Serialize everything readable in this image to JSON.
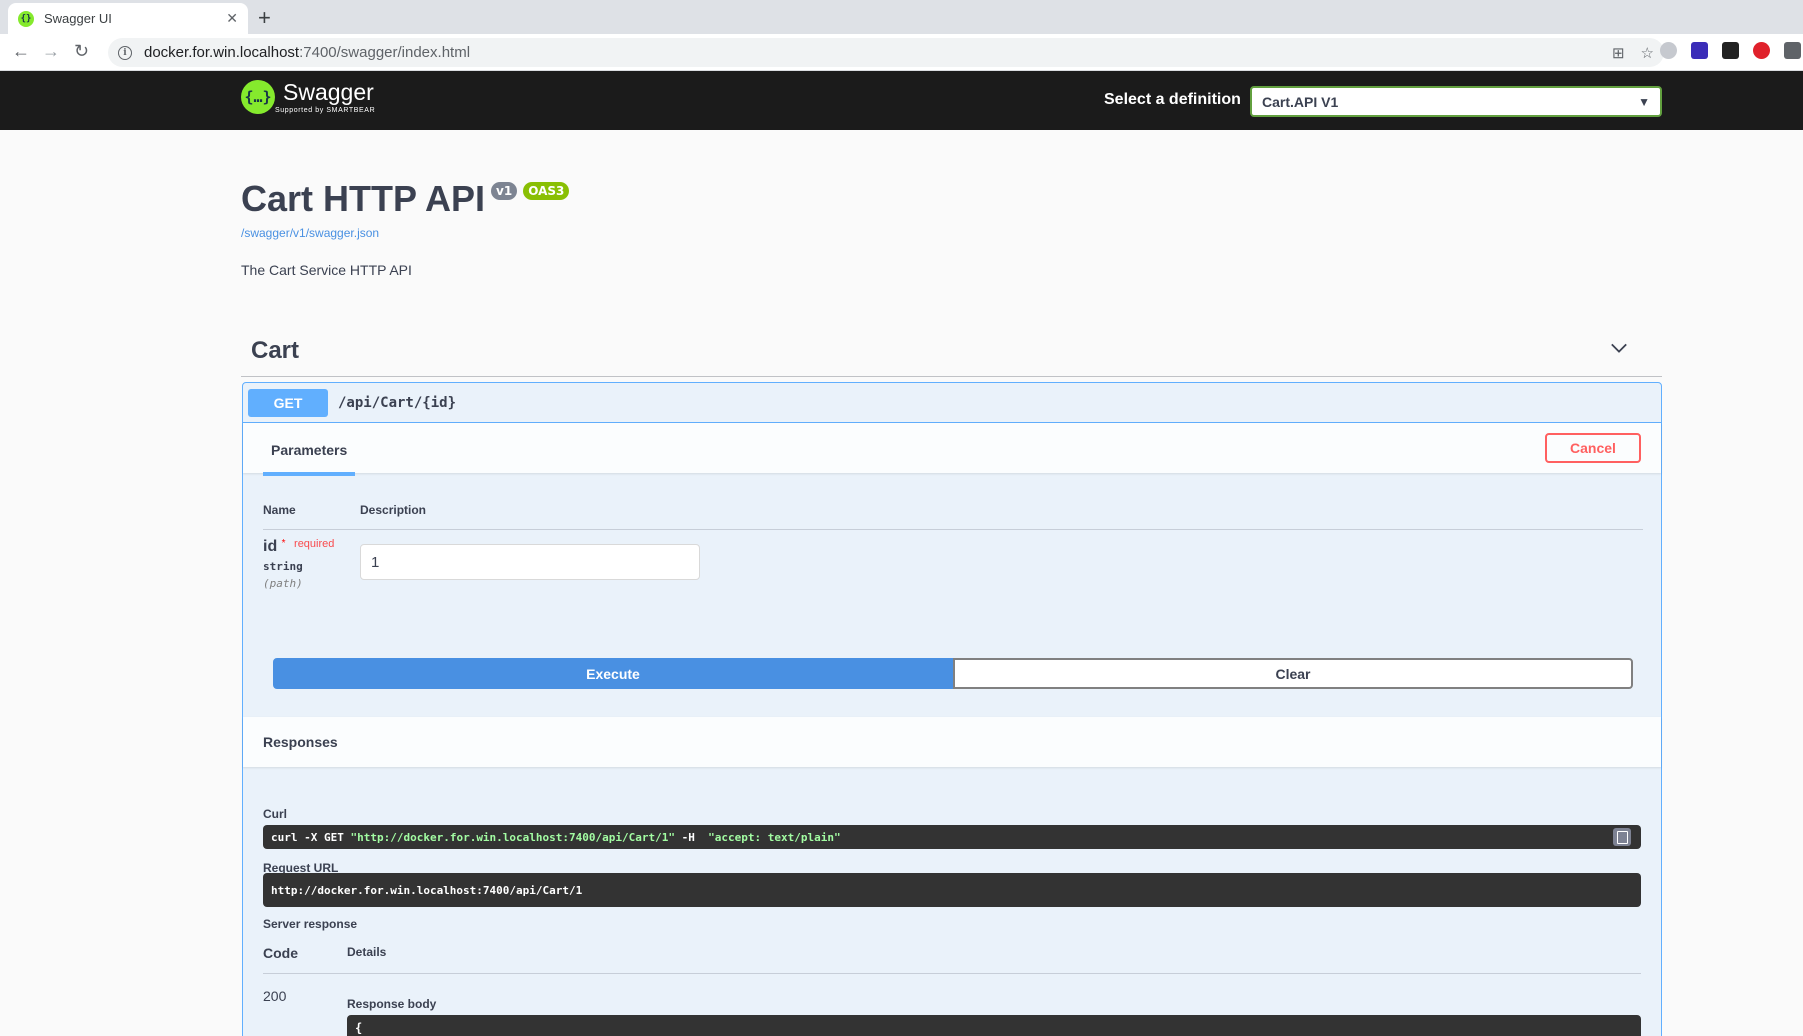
{
  "browser": {
    "tab_title": "Swagger UI",
    "tab_close": "✕",
    "new_tab": "+",
    "url_host": "docker.for.win.localhost",
    "url_path": ":7400/swagger/index.html",
    "back": "←",
    "forward": "→",
    "reload": "↻",
    "star": "☆",
    "translate": "⊞"
  },
  "topbar": {
    "logo_text": "Swagger",
    "logo_sub": "Supported by SMARTBEAR",
    "logo_glyph": "{…}",
    "definition_label": "Select a definition",
    "definition_value": "Cart.API V1"
  },
  "info": {
    "title": "Cart HTTP API",
    "version_badge": "v1",
    "oas_badge": "OAS3",
    "spec_url": "/swagger/v1/swagger.json",
    "description": "The Cart Service HTTP API"
  },
  "tag": {
    "name": "Cart"
  },
  "operation": {
    "method": "GET",
    "path": "/api/Cart/{id}",
    "parameters_tab": "Parameters",
    "cancel_label": "Cancel",
    "col_name": "Name",
    "col_description": "Description",
    "param": {
      "name": "id",
      "star": "*",
      "required": "required",
      "type": "string",
      "in": "(path)",
      "value": "1"
    },
    "execute_label": "Execute",
    "clear_label": "Clear"
  },
  "responses": {
    "heading": "Responses",
    "curl_label": "Curl",
    "curl_cmd": "curl -X GET ",
    "curl_url": "\"http://docker.for.win.localhost:7400/api/Cart/1\"",
    "curl_flag": " -H  ",
    "curl_header": "\"accept: text/plain\"",
    "request_url_label": "Request URL",
    "request_url": "http://docker.for.win.localhost:7400/api/Cart/1",
    "server_response_label": "Server response",
    "code_header": "Code",
    "details_header": "Details",
    "code": "200",
    "response_body_label": "Response body",
    "response_body_start": "{"
  },
  "colors": {
    "get_blue": "#61affe",
    "swagger_green": "#85ea2d",
    "cancel_red": "#ff6060",
    "execute_blue": "#4990e2"
  }
}
